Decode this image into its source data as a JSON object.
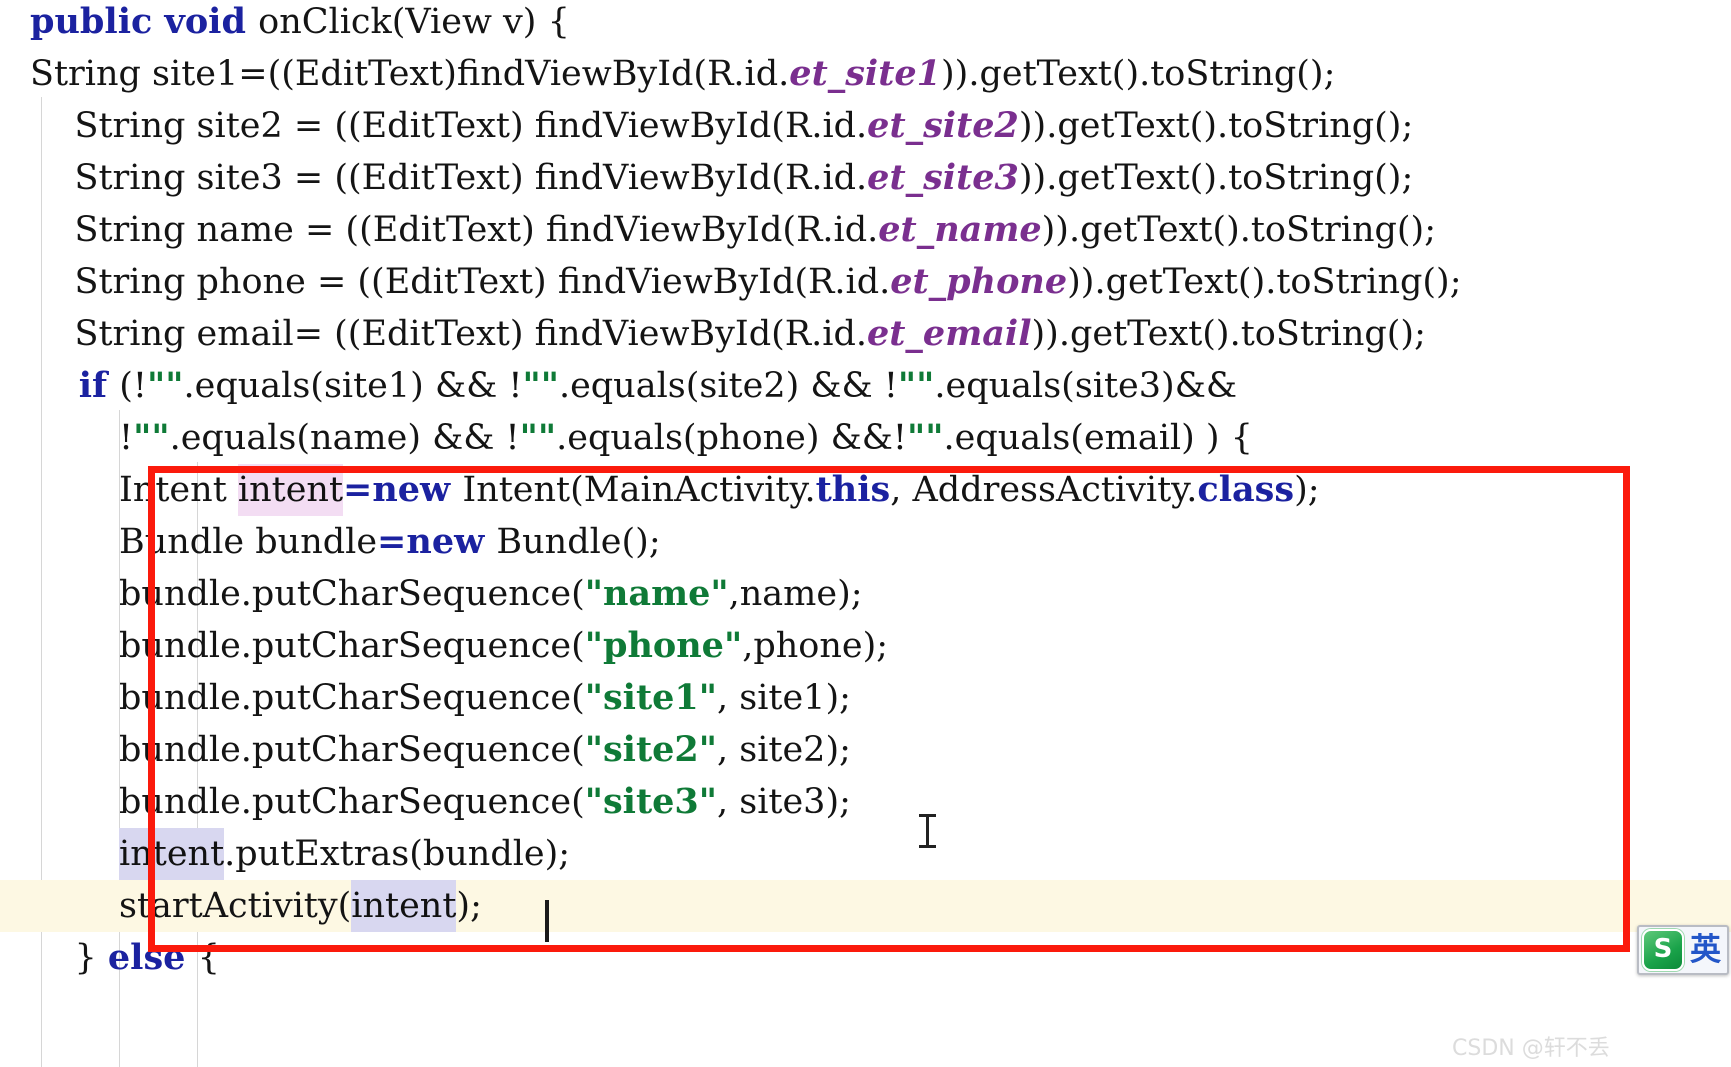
{
  "editor": {
    "language": "java",
    "font_size_px": 35,
    "line_height_px": 52,
    "background": "#ffffff",
    "current_line_background": "#fdf8e3",
    "occurrence_highlight_pink": "#f3ddf3",
    "occurrence_highlight_lavender": "#d8d7f0",
    "colors": {
      "keyword": "#1b22a0",
      "string": "#0f7a37",
      "field": "#7a2f8f",
      "plain": "#141414",
      "indent_guide": "#d6d6d6",
      "annotation_red": "#fb1a0c"
    },
    "lines": [
      {
        "id": "line-01",
        "tokens": [
          {
            "t": "kw",
            "s": "public void "
          },
          {
            "t": "plain",
            "s": "onClick(View v) {"
          }
        ]
      },
      {
        "id": "line-02",
        "tokens": [
          {
            "t": "plain",
            "s": "String site1=((EditText)findViewById(R.id."
          },
          {
            "t": "field",
            "s": "et_site1"
          },
          {
            "t": "plain",
            "s": ")).getText().toString();"
          }
        ]
      },
      {
        "id": "line-03",
        "tokens": [
          {
            "t": "plain",
            "s": "    String site2 = ((EditText) findViewById(R.id."
          },
          {
            "t": "field",
            "s": "et_site2"
          },
          {
            "t": "plain",
            "s": ")).getText().toString();"
          }
        ]
      },
      {
        "id": "line-04",
        "tokens": [
          {
            "t": "plain",
            "s": "    String site3 = ((EditText) findViewById(R.id."
          },
          {
            "t": "field",
            "s": "et_site3"
          },
          {
            "t": "plain",
            "s": ")).getText().toString();"
          }
        ]
      },
      {
        "id": "line-05",
        "tokens": [
          {
            "t": "plain",
            "s": "    String name = ((EditText) findViewById(R.id."
          },
          {
            "t": "field",
            "s": "et_name"
          },
          {
            "t": "plain",
            "s": ")).getText().toString();"
          }
        ]
      },
      {
        "id": "line-06",
        "tokens": [
          {
            "t": "plain",
            "s": "    String phone = ((EditText) findViewById(R.id."
          },
          {
            "t": "field",
            "s": "et_phone"
          },
          {
            "t": "plain",
            "s": ")).getText().toString();"
          }
        ]
      },
      {
        "id": "line-07",
        "tokens": [
          {
            "t": "plain",
            "s": "    String email= ((EditText) findViewById(R.id."
          },
          {
            "t": "field",
            "s": "et_email"
          },
          {
            "t": "plain",
            "s": ")).getText().toString();"
          }
        ]
      },
      {
        "id": "line-08",
        "tokens": [
          {
            "t": "kw",
            "s": "    if "
          },
          {
            "t": "plain",
            "s": "(!"
          },
          {
            "t": "str",
            "s": "\"\""
          },
          {
            "t": "plain",
            "s": ".equals(site1) && !"
          },
          {
            "t": "str",
            "s": "\"\""
          },
          {
            "t": "plain",
            "s": ".equals(site2) && !"
          },
          {
            "t": "str",
            "s": "\"\""
          },
          {
            "t": "plain",
            "s": ".equals(site3)&&"
          }
        ]
      },
      {
        "id": "line-09",
        "tokens": [
          {
            "t": "plain",
            "s": "        !"
          },
          {
            "t": "str",
            "s": "\"\""
          },
          {
            "t": "plain",
            "s": ".equals(name) && !"
          },
          {
            "t": "str",
            "s": "\"\""
          },
          {
            "t": "plain",
            "s": ".equals(phone) &&!"
          },
          {
            "t": "str",
            "s": "\"\""
          },
          {
            "t": "plain",
            "s": ".equals(email) ) {"
          }
        ]
      },
      {
        "id": "line-10",
        "tokens": [
          {
            "t": "plain",
            "s": "        Intent "
          },
          {
            "t": "hl",
            "s": "intent"
          },
          {
            "t": "kw",
            "s": "=new "
          },
          {
            "t": "plain",
            "s": "Intent(MainActivity."
          },
          {
            "t": "kw",
            "s": "this"
          },
          {
            "t": "plain",
            "s": ", AddressActivity."
          },
          {
            "t": "kw",
            "s": "class"
          },
          {
            "t": "plain",
            "s": ");"
          }
        ]
      },
      {
        "id": "line-11",
        "tokens": [
          {
            "t": "plain",
            "s": "        Bundle bundle"
          },
          {
            "t": "kw",
            "s": "=new "
          },
          {
            "t": "plain",
            "s": "Bundle();"
          }
        ]
      },
      {
        "id": "line-12",
        "tokens": [
          {
            "t": "plain",
            "s": "        bundle.putCharSequence("
          },
          {
            "t": "str",
            "s": "\"name\""
          },
          {
            "t": "plain",
            "s": ",name);"
          }
        ]
      },
      {
        "id": "line-13",
        "tokens": [
          {
            "t": "plain",
            "s": "        bundle.putCharSequence("
          },
          {
            "t": "str",
            "s": "\"phone\""
          },
          {
            "t": "plain",
            "s": ",phone);"
          }
        ]
      },
      {
        "id": "line-14",
        "tokens": [
          {
            "t": "plain",
            "s": "        bundle.putCharSequence("
          },
          {
            "t": "str",
            "s": "\"site1\""
          },
          {
            "t": "plain",
            "s": ", site1);"
          }
        ]
      },
      {
        "id": "line-15",
        "tokens": [
          {
            "t": "plain",
            "s": "        bundle.putCharSequence("
          },
          {
            "t": "str",
            "s": "\"site2\""
          },
          {
            "t": "plain",
            "s": ", site2);"
          }
        ]
      },
      {
        "id": "line-16",
        "tokens": [
          {
            "t": "plain",
            "s": "        bundle.putCharSequence("
          },
          {
            "t": "str",
            "s": "\"site3\""
          },
          {
            "t": "plain",
            "s": ", site3);"
          }
        ]
      },
      {
        "id": "line-17",
        "tokens": [
          {
            "t": "plain",
            "s": "        "
          },
          {
            "t": "hl2",
            "s": "intent"
          },
          {
            "t": "plain",
            "s": ".putExtras(bundle);"
          }
        ]
      },
      {
        "id": "line-18",
        "current": true,
        "tokens": [
          {
            "t": "plain",
            "s": "        startActivity("
          },
          {
            "t": "hl2",
            "s": "intent"
          },
          {
            "t": "plain",
            "s": ");"
          }
        ]
      },
      {
        "id": "line-19",
        "clipped": true,
        "tokens": [
          {
            "t": "plain",
            "s": "    } "
          },
          {
            "t": "kw",
            "s": "else "
          },
          {
            "t": "plain",
            "s": "{"
          }
        ]
      }
    ]
  },
  "annotation": {
    "shape": "rectangle",
    "color": "#fb1a0c",
    "border_px": 7
  },
  "caret": {
    "visible": true,
    "color": "#1a1a1a"
  },
  "mouse_cursor": {
    "shape": "i-beam"
  },
  "ime": {
    "name": "sogou-input-method",
    "logo_letter": "S",
    "mode_label": "英"
  },
  "watermark": {
    "text": "CSDN @轩不丢"
  }
}
